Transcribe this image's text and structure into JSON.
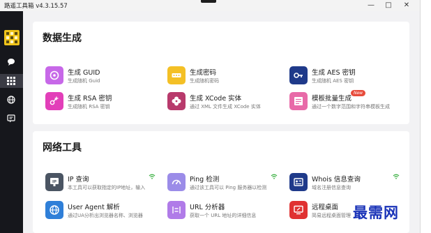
{
  "app": {
    "title": "路遥工具箱 v4.3.15.57"
  },
  "window_controls": {
    "minimize": "—",
    "maximize": "□",
    "close": "✕"
  },
  "sections": {
    "data": {
      "title": "数据生成",
      "tools": [
        {
          "name": "生成 GUID",
          "desc": "生成随机 Guid",
          "icon": "guid-icon",
          "color": "#c768e8"
        },
        {
          "name": "生成密码",
          "desc": "生成随机密码",
          "icon": "password-icon",
          "color": "#f4c026"
        },
        {
          "name": "生成 AES 密钥",
          "desc": "生成随机 AES 密钥",
          "icon": "key-icon",
          "color": "#1f3a8a"
        },
        {
          "name": "生成 RSA 密钥",
          "desc": "生成随机 RSA 密钥",
          "icon": "key-plus-icon",
          "color": "#e23fb9"
        },
        {
          "name": "生成 XCode 实体",
          "desc": "通过 XML 文件生成 XCode 实体",
          "icon": "xcode-icon",
          "color": "#b83a6c"
        },
        {
          "name": "模板批量生成",
          "desc": "通过一个数字范围和字符串模板生成",
          "icon": "template-icon",
          "color": "#e86aa8",
          "badge": "New"
        }
      ]
    },
    "network": {
      "title": "网络工具",
      "tools": [
        {
          "name": "IP 查询",
          "desc": "本工具可以获取指定的IP地址，输入",
          "icon": "ip-icon",
          "color": "#4b5563",
          "wifi": true
        },
        {
          "name": "Ping 检测",
          "desc": "通过该工具可以 Ping 服务器以检测",
          "icon": "gauge-icon",
          "color": "#9b8ce8",
          "wifi": true
        },
        {
          "name": "Whois 信息查询",
          "desc": "域名注册信息查询",
          "icon": "whois-icon",
          "color": "#1f3a8a",
          "wifi": true
        },
        {
          "name": "User Agent 解析",
          "desc": "通过UA分析出浏览器名称、浏览器",
          "icon": "globe-icon",
          "color": "#2f7fd8"
        },
        {
          "name": "URL 分析器",
          "desc": "获取一个 URL 地址的详细信息",
          "icon": "url-icon",
          "color": "#b07be8"
        },
        {
          "name": "远程桌面",
          "desc": "简易远程桌面管理",
          "icon": "remote-desktop-icon",
          "color": "#e03131"
        }
      ]
    }
  },
  "watermark": "最需网"
}
